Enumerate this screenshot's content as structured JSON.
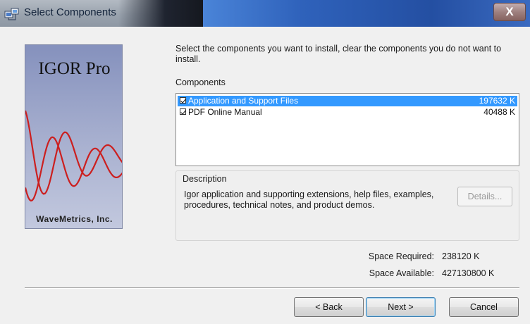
{
  "window": {
    "title": "Select Components",
    "close_label": "X",
    "title_icon": "installer-icon"
  },
  "logo": {
    "product": "IGOR Pro",
    "company": "WaveMetrics, Inc.",
    "wave_color": "#cc1f1f"
  },
  "instruction": "Select the components you want to install, clear the components you do not want to install.",
  "components": {
    "label": "Components",
    "items": [
      {
        "name": "Application and Support Files",
        "size": "197632 K",
        "checked": true,
        "selected": true
      },
      {
        "name": "PDF Online Manual",
        "size": "40488 K",
        "checked": true,
        "selected": false
      }
    ]
  },
  "description": {
    "label": "Description",
    "text": "Igor application and supporting extensions, help files, examples, procedures, technical notes, and product demos.",
    "details_label": "Details..."
  },
  "space": {
    "required_label": "Space Required:",
    "required_value": "238120 K",
    "available_label": "Space Available:",
    "available_value": "427130800 K"
  },
  "buttons": {
    "back": "< Back",
    "next": "Next >",
    "cancel": "Cancel"
  },
  "colors": {
    "selection": "#3399ff",
    "title_bar": "#2f62bb"
  }
}
